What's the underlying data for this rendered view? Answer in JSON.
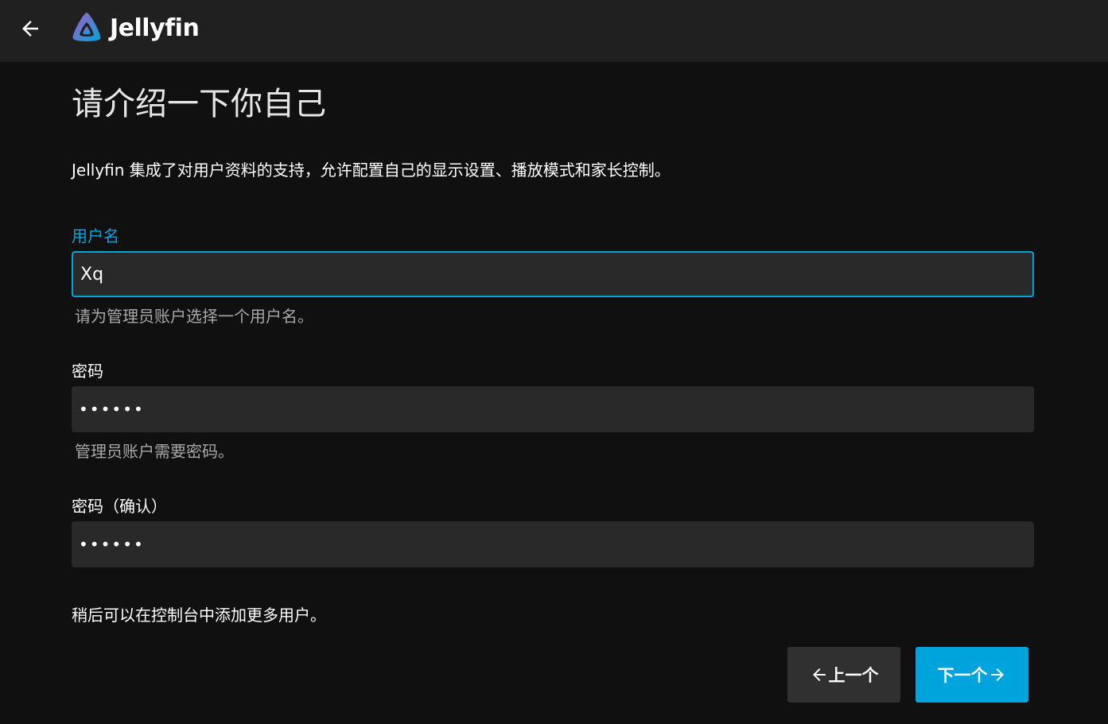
{
  "app": {
    "name": "Jellyfin",
    "accent_color": "#00a4dc",
    "back_icon": "arrow-left-icon",
    "logo_icon": "jellyfin-logo-icon"
  },
  "page": {
    "title": "请介绍一下你自己",
    "intro": "Jellyfin 集成了对用户资料的支持，允许配置自己的显示设置、播放模式和家长控制。",
    "footnote": "稍后可以在控制台中添加更多用户。"
  },
  "form": {
    "username": {
      "label": "用户名",
      "value": "Xq",
      "hint": "请为管理员账户选择一个用户名。"
    },
    "password": {
      "label": "密码",
      "value": "••••••",
      "hint": "管理员账户需要密码。"
    },
    "password_confirm": {
      "label": "密码（确认）",
      "value": "••••••"
    }
  },
  "buttons": {
    "previous": "上一个",
    "next": "下一个"
  }
}
